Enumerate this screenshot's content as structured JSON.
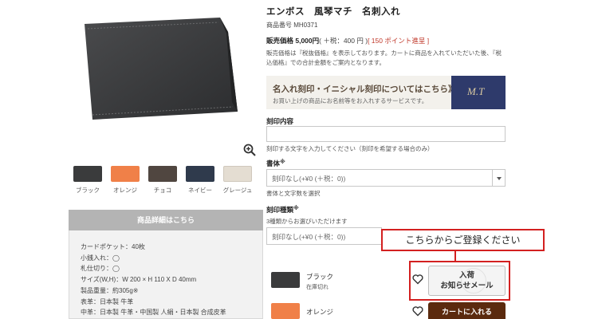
{
  "product": {
    "title": "エンボス　風琴マチ　名刺入れ",
    "code": "商品番号 MH0371",
    "price_label": "販売価格 5,000円",
    "price_tax": "( ＋税：400 円 )",
    "price_points": "[ 150 ポイント進呈 ]",
    "price_note": "販売価格は『税抜価格』を表示しております。カートに商品を入れていただいた後、『税込価格』での合計金額をご案内となります。"
  },
  "swatches": [
    {
      "label": "ブラック",
      "color": "#3a3b3c"
    },
    {
      "label": "オレンジ",
      "color": "#f08048"
    },
    {
      "label": "チョコ",
      "color": "#504640"
    },
    {
      "label": "ネイビー",
      "color": "#2f3a4c"
    },
    {
      "label": "グレージュ",
      "color": "#e4ddd2"
    }
  ],
  "details": {
    "header": "商品詳細はこちら",
    "lines": [
      "カードポケット：40枚",
      "小銭入れ：◯",
      "札仕切り：◯",
      "サイズ(W,H)：W 200 × H 110 X D 40mm",
      "製品重量：約305g※",
      "表革：日本製 牛革",
      "中革：日本製 牛革・中国製 人絹・日本製 合成皮革"
    ]
  },
  "banner": {
    "title": "名入れ刻印・イニシャル刻印についてはこちら》",
    "subtitle": "お買い上げの商品にお名前等をお入れするサービスです。",
    "monogram": "M.T"
  },
  "form": {
    "engrave_label": "刻印内容",
    "engrave_help": "刻印する文字を入力してください（刻印を希望する場合のみ）",
    "font_label": "書体",
    "required_mark": "※",
    "font_value": "刻印なし(+¥0 (＋税：0))",
    "font_help": "書体と文字数を選択",
    "type_label": "刻印種類",
    "type_help": "3種類からお選びいただけます",
    "type_value": "刻印なし(+¥0 (＋税：0))"
  },
  "variants": [
    {
      "name": "ブラック",
      "stock": "在庫切れ",
      "color": "#3a3b3c"
    },
    {
      "name": "オレンジ",
      "stock": "",
      "color": "#f08048"
    }
  ],
  "callout": "こちらからご登録ください",
  "notify_button": {
    "line1": "入荷",
    "line2": "お知らせメール"
  },
  "cart_button": "カートに入れる",
  "accent_color": "#d32020"
}
